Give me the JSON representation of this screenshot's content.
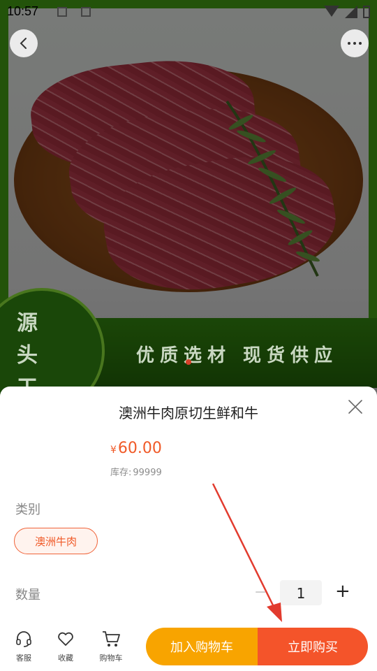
{
  "status_bar": {
    "time": "10:57",
    "icons": [
      "image-icon",
      "a-badge-icon",
      "wifi-icon",
      "signal-icon",
      "battery-icon"
    ]
  },
  "hero": {
    "slogan_left": "源 头 工 厂",
    "slogan_right": "优质选材 现货供应",
    "image_alt": "beef-steak-on-plate"
  },
  "header": {
    "back_icon": "chevron-left-icon",
    "more_icon": "more-horizontal-icon"
  },
  "product": {
    "title": "澳洲牛肉原切生鲜和牛",
    "price_symbol": "¥",
    "price": "60.00",
    "stock_label": "库存:",
    "stock_value": "99999"
  },
  "options": {
    "category_label": "类别",
    "category_selected": "澳洲牛肉",
    "quantity_label": "数量",
    "quantity_minus": "−",
    "quantity_value": "1",
    "quantity_plus": "+"
  },
  "action_bar": {
    "service_label": "客服",
    "favorite_label": "收藏",
    "cart_label": "购物车",
    "add_to_cart": "加入购物车",
    "buy_now": "立即购买"
  },
  "colors": {
    "accent": "#f05a28",
    "cart_button": "#f8a400",
    "buy_button": "#f4542a",
    "frame_green": "#3d8f12"
  }
}
